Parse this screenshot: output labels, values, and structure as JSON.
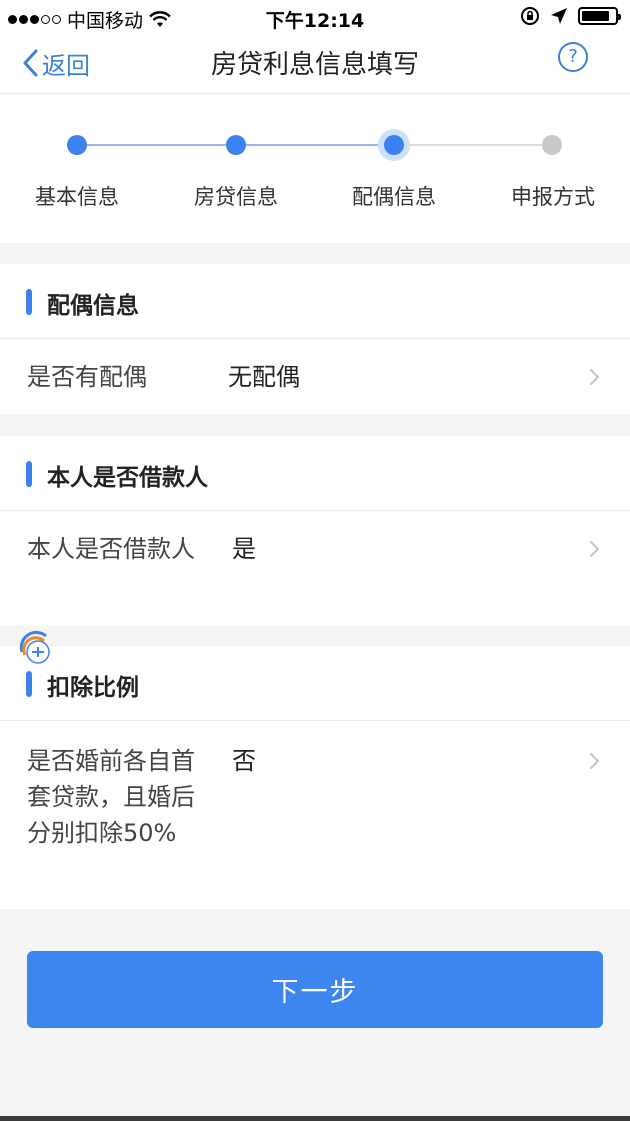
{
  "status_bar": {
    "carrier": "中国移动",
    "time": "下午12:14"
  },
  "nav": {
    "back_label": "返回",
    "title": "房贷利息信息填写",
    "help_label": "?"
  },
  "stepper": {
    "steps": [
      {
        "label": "基本信息",
        "state": "done"
      },
      {
        "label": "房贷信息",
        "state": "done"
      },
      {
        "label": "配偶信息",
        "state": "current"
      },
      {
        "label": "申报方式",
        "state": "todo"
      }
    ]
  },
  "sections": [
    {
      "title": "配偶信息",
      "row": {
        "label": "是否有配偶",
        "value": "无配偶"
      }
    },
    {
      "title": "本人是否借款人",
      "row": {
        "label": "本人是否借款人",
        "value": "是"
      }
    },
    {
      "title": "扣除比例",
      "row": {
        "label": "是否婚前各自首套贷款，且婚后分别扣除50%",
        "value": "否"
      }
    }
  ],
  "next_button": {
    "label": "下一步"
  },
  "colors": {
    "accent": "#3b82f0",
    "button": "#3d86ef",
    "inactive": "#c8c8c8",
    "background": "#f4f5f7"
  }
}
